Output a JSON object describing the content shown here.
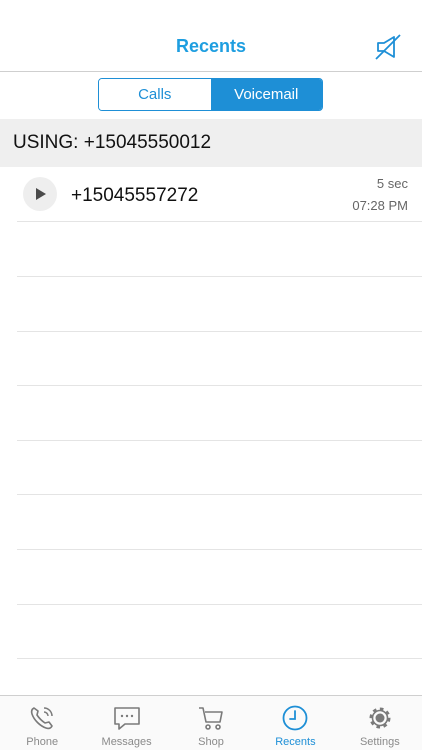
{
  "header": {
    "title": "Recents"
  },
  "segments": {
    "calls": "Calls",
    "voicemail": "Voicemail",
    "selected": "voicemail"
  },
  "using": {
    "text": "USING: +15045550012"
  },
  "voicemails": [
    {
      "number": "+15045557272",
      "duration": "5 sec",
      "time": "07:28 PM"
    }
  ],
  "tabs": [
    {
      "label": "Phone",
      "icon": "phone-icon"
    },
    {
      "label": "Messages",
      "icon": "messages-icon"
    },
    {
      "label": "Shop",
      "icon": "cart-icon"
    },
    {
      "label": "Recents",
      "icon": "clock-icon",
      "active": true
    },
    {
      "label": "Settings",
      "icon": "gear-icon"
    }
  ],
  "colors": {
    "accent": "#1e8fd6",
    "title": "#1e9ee0"
  }
}
